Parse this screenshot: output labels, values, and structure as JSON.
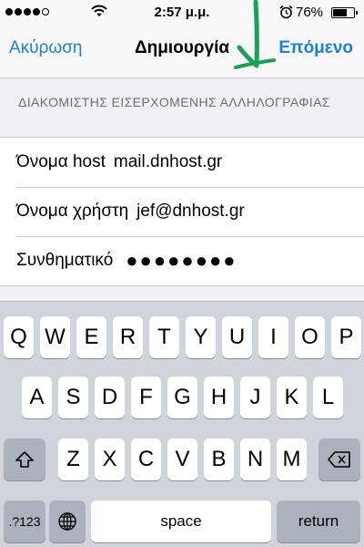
{
  "status_bar": {
    "signal_dots": 5,
    "signal_filled": 4,
    "time": "2:57 μ.μ.",
    "battery_percent_text": "76%",
    "battery_level": 0.76,
    "icons": [
      "wifi-icon",
      "alarm-icon",
      "battery-icon"
    ]
  },
  "nav": {
    "cancel_label": "Ακύρωση",
    "title": "Δημιουργία",
    "next_label": "Επόμενο",
    "accent_color": "#1f7fd6",
    "annotation_color": "#1aa05a"
  },
  "section": {
    "header": "ΔΙΑΚΟΜΙΣΤΗΣ ΕΙΣΕΡΧΟΜΕΝΗΣ ΑΛΛΗΛΟΓΡΑΦΙΑΣ"
  },
  "fields": [
    {
      "label": "Όνομα host",
      "value": "mail.dnhost.gr"
    },
    {
      "label": "Όνομα χρήστη",
      "value": "jef@dnhost.gr"
    },
    {
      "label": "Συνθηματικό",
      "value": "●●●●●●●●"
    }
  ],
  "keyboard": {
    "row1": [
      "Q",
      "W",
      "E",
      "R",
      "T",
      "Y",
      "U",
      "I",
      "O",
      "P"
    ],
    "row2": [
      "A",
      "S",
      "D",
      "F",
      "G",
      "H",
      "J",
      "K",
      "L"
    ],
    "row3": [
      "Z",
      "X",
      "C",
      "V",
      "B",
      "N",
      "M"
    ],
    "numbers_label": ".?123",
    "space_label": "space",
    "return_label": "return",
    "icons": [
      "shift-icon",
      "delete-icon",
      "globe-icon"
    ]
  }
}
